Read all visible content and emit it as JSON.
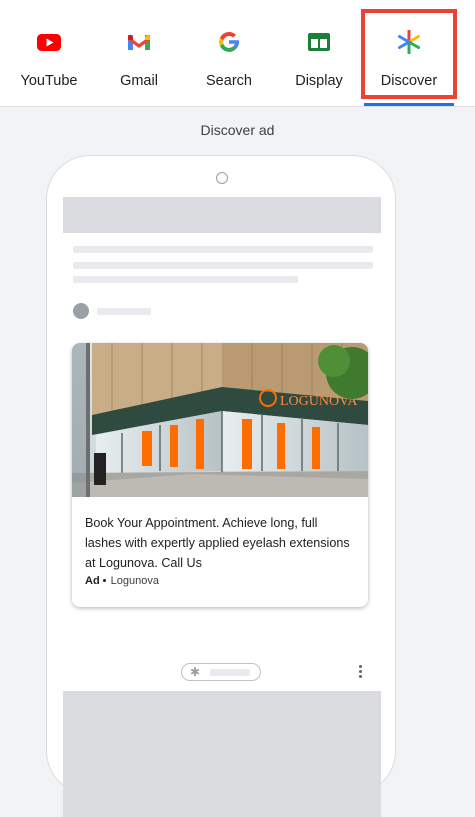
{
  "tabs": [
    {
      "label": "YouTube",
      "icon": "youtube-icon",
      "active": false
    },
    {
      "label": "Gmail",
      "icon": "gmail-icon",
      "active": false
    },
    {
      "label": "Search",
      "icon": "google-icon",
      "active": false
    },
    {
      "label": "Display",
      "icon": "display-icon",
      "active": false
    },
    {
      "label": "Discover",
      "icon": "discover-icon",
      "active": true
    }
  ],
  "colors": {
    "accent": "#1a73e8",
    "highlight": "#ea4335",
    "youtube": "#ff0000",
    "display": "#188038",
    "orange_sign": "#ff6d00"
  },
  "section_label": "Discover ad",
  "ad": {
    "text": "Book Your Appointment. Achieve long, full lashes with expertly applied eyelash extensions at Logunova. Call Us",
    "badge": "Ad",
    "advertiser": "Logunova",
    "image_sign": "LOGUNOVA"
  },
  "footer_icons": {
    "pill": "discover-star-icon",
    "menu": "more-vert-icon"
  }
}
